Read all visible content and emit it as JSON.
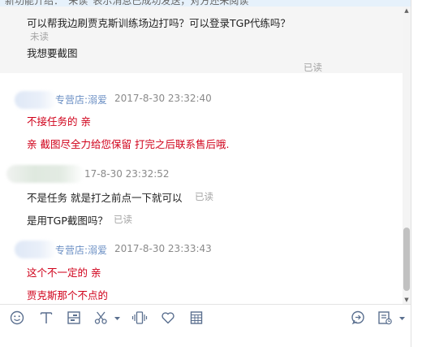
{
  "banner": {
    "text": "新功能介绍：“未读”表示消息已成功发送，对方还未阅读"
  },
  "messages": {
    "m1_text": "可以帮我边刷贾克斯训练场边打吗？可以登录TGP代练吗？",
    "m1_status": "未读",
    "m2_text": "我想要截图",
    "m2_status": "已读",
    "h1_name": "专营店:溺爱",
    "h1_time": "2017-8-30 23:32:40",
    "r1": "不接任务的 亲",
    "r2": "亲  截图尽全力给您保留   打完之后联系售后哦.",
    "h2_time": "17-8-30 23:32:52",
    "m3_text": "不是任务  就是打之前点一下就可以",
    "m3_status": "已读",
    "m4_text": "是用TGP截图吗？",
    "m4_status": "已读",
    "h3_name": "专营店:溺爱",
    "h3_time": "2017-8-30 23:33:43",
    "r3": "这个不一定的 亲",
    "r4": "贾克斯那个不点的"
  },
  "colors": {
    "link_blue": "#6b8fc4",
    "reply_red": "#d0021b",
    "status_gray": "#a5a5a5"
  },
  "toolbar": {
    "icons": [
      "emoji-icon",
      "font-icon",
      "image-icon",
      "scissors-icon",
      "shake-icon",
      "heart-icon",
      "calendar-icon",
      "chat-bubble-icon",
      "history-icon"
    ]
  }
}
